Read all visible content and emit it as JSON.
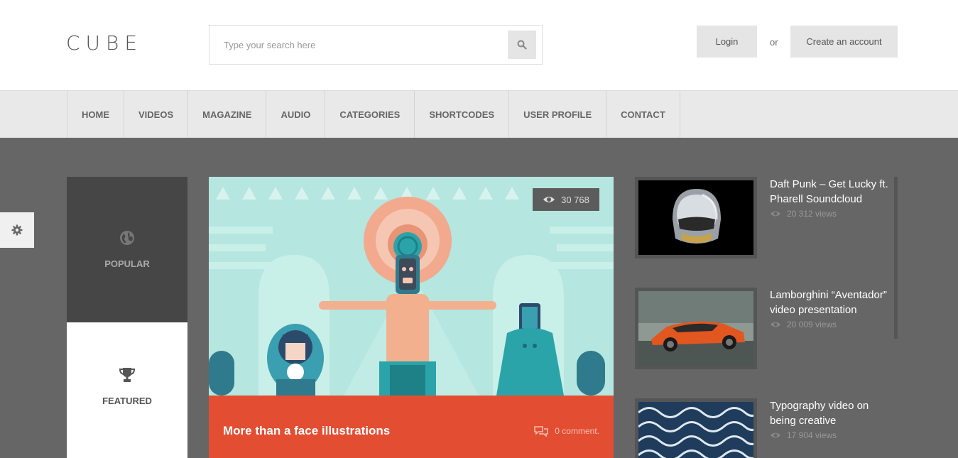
{
  "header": {
    "logo": "CUBE",
    "search_placeholder": "Type your search here",
    "login_label": "Login",
    "or_label": "or",
    "create_account_label": "Create an account"
  },
  "nav": {
    "items": [
      "HOME",
      "VIDEOS",
      "MAGAZINE",
      "AUDIO",
      "CATEGORIES",
      "SHORTCODES",
      "USER PROFILE",
      "CONTACT"
    ]
  },
  "tabs": {
    "popular": "POPULAR",
    "featured": "FEATURED"
  },
  "featured_post": {
    "views": "30 768",
    "title": "More than a face illustrations",
    "comments": "0 comment."
  },
  "side_videos": [
    {
      "title": "Daft Punk – Get Lucky ft. Pharell Soundcloud",
      "views": "20 312 views"
    },
    {
      "title": "Lamborghini “Aventador” video presentation",
      "views": "20 009 views"
    },
    {
      "title": "Typography video on being creative",
      "views": "17 904 views"
    }
  ],
  "colors": {
    "accent": "#e34e33",
    "main_bg": "#666666",
    "nav_bg": "#e9e9e9"
  },
  "icons": {
    "search": "search-icon",
    "settings": "gear-icon",
    "popular": "globe-icon",
    "featured": "trophy-icon",
    "views": "eye-icon",
    "comments": "comment-icon"
  }
}
